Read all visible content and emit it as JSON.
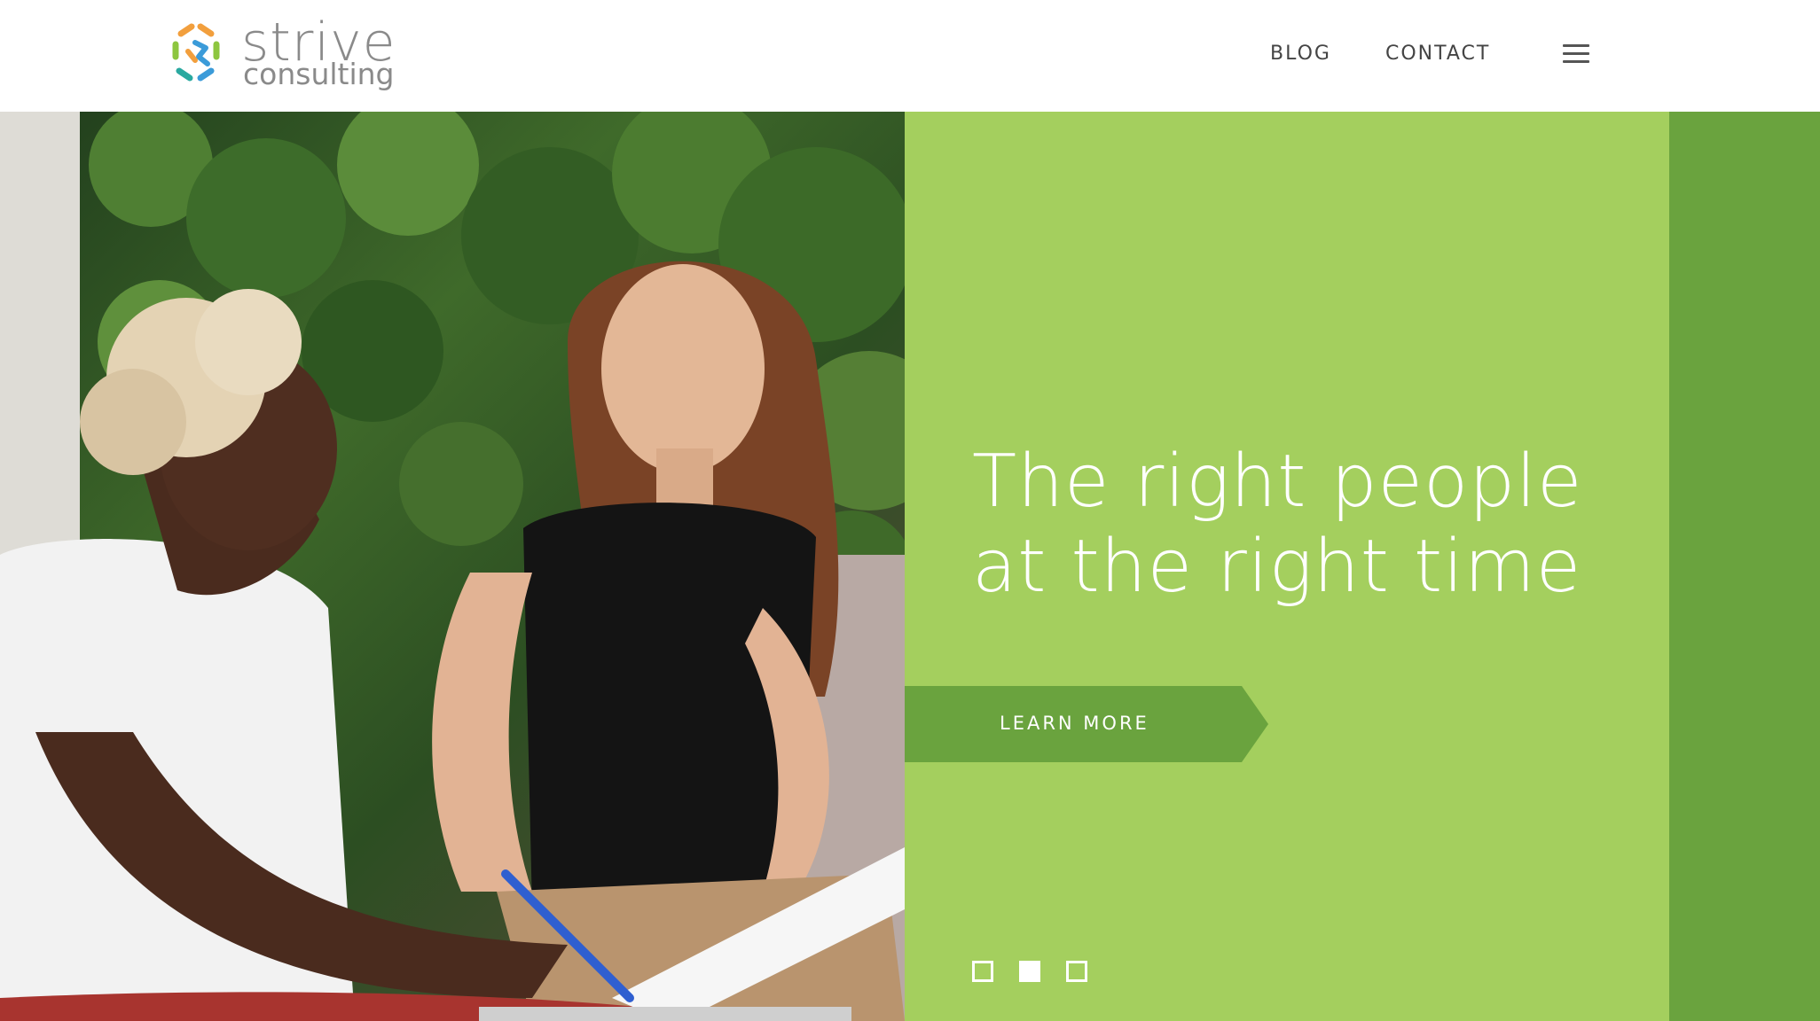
{
  "brand": {
    "name": "strive",
    "tagline": "consulting",
    "colors": {
      "green": "#8dc63f",
      "teal": "#2aa9a0",
      "blue": "#3b9bd9",
      "orange": "#f29f3d"
    }
  },
  "nav": {
    "links": [
      {
        "label": "BLOG"
      },
      {
        "label": "CONTACT"
      }
    ],
    "menu_icon": "hamburger-icon"
  },
  "hero": {
    "headline_line1": "The right people",
    "headline_line2": "at the right time",
    "cta_label": "LEARN MORE",
    "slides": {
      "count": 3,
      "active": 2
    },
    "colors": {
      "panel": "#a4cf5e",
      "strip": "#6aa33e",
      "cta": "#6aa33e"
    }
  }
}
